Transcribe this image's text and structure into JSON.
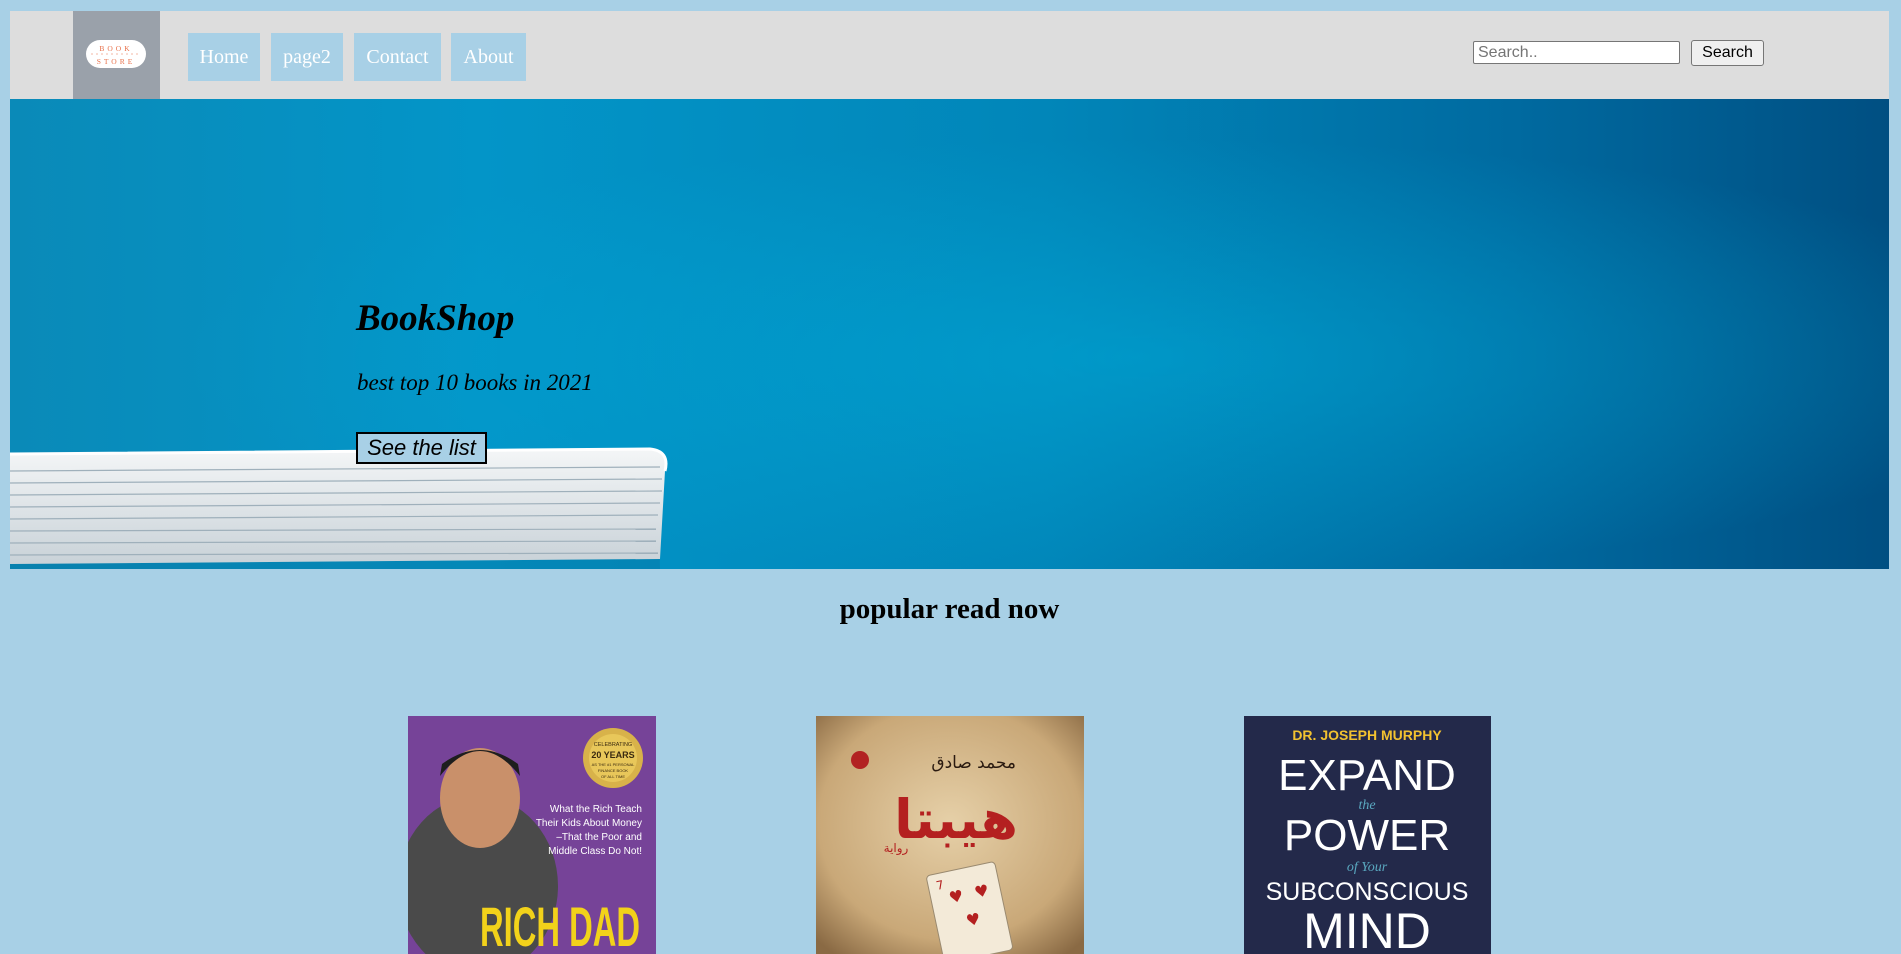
{
  "navbar": {
    "logo": {
      "line1": "BOOK",
      "line2": "STORE"
    },
    "links": [
      "Home",
      "page2",
      "Contact",
      "About"
    ],
    "search": {
      "placeholder": "Search..",
      "value": "",
      "button_label": "Search"
    }
  },
  "hero": {
    "title": "BookShop",
    "subtitle": "best top 10 books in 2021",
    "button_label": "See the list"
  },
  "popular": {
    "heading": "popular read now",
    "books": [
      {
        "badge": [
          "CELEBRATING",
          "20 YEARS",
          "AS THE #1 PERSONAL",
          "FINANCE BOOK",
          "OF ALL TIME"
        ],
        "tagline": [
          "What the Rich Teach",
          "Their Kids About Money",
          "–That the Poor and",
          "Middle Class Do Not!"
        ],
        "title": "RICH DAD"
      },
      {
        "author": "محمد صادق",
        "title": "هيبتا",
        "genre": "رواية"
      },
      {
        "author": "DR. JOSEPH MURPHY",
        "title_lines": [
          "EXPAND",
          "the",
          "POWER",
          "of Your",
          "SUBCONSCIOUS",
          "MIND"
        ]
      }
    ]
  },
  "colors": {
    "page_bg": "#a8d0e6",
    "navbar_bg": "#dddddd",
    "nav_link_bg": "#a8d0e6",
    "logo_bg": "#9aa1aa",
    "hero_blue": "#0395c8"
  }
}
